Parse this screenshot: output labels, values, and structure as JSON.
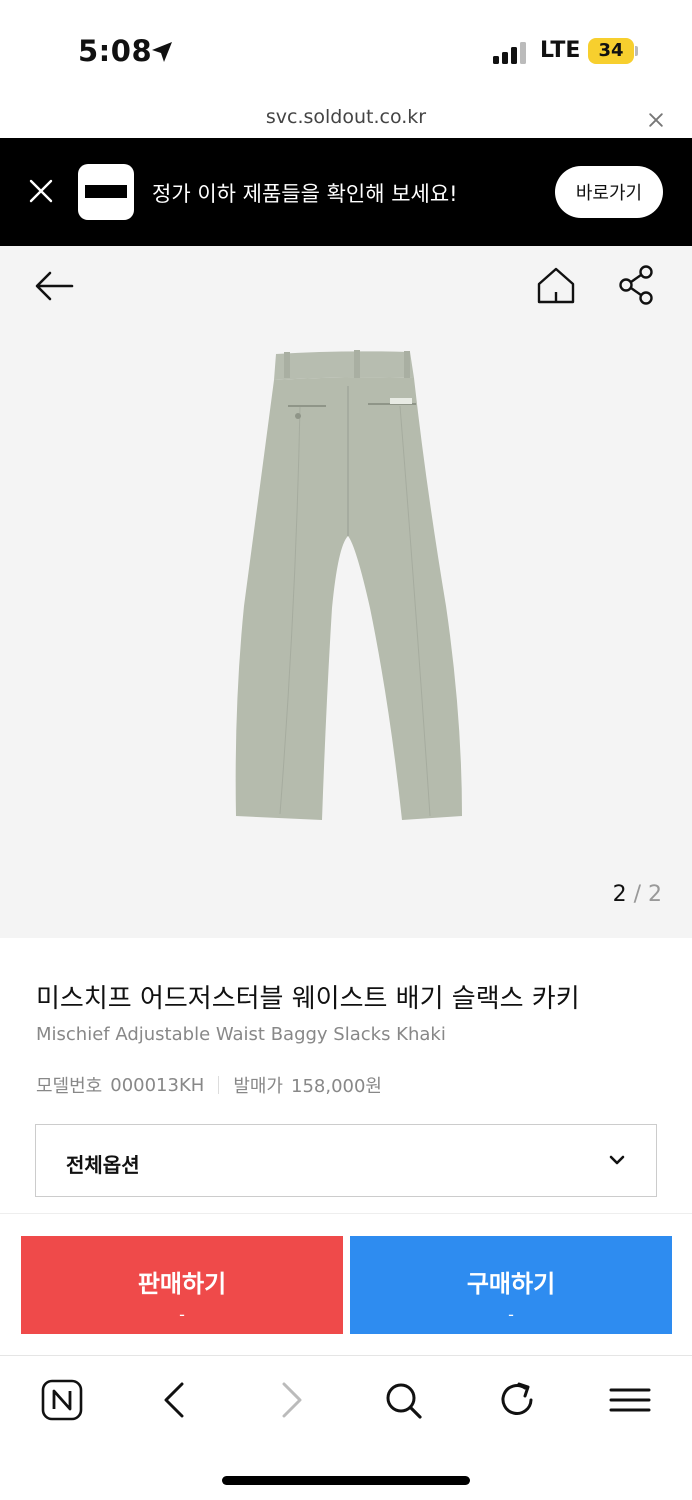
{
  "status_bar": {
    "time": "5:08",
    "network": "LTE",
    "battery": "34",
    "icons": [
      "location-arrow-icon",
      "signal-icon",
      "battery-icon"
    ]
  },
  "browser": {
    "url": "svc.soldout.co.kr",
    "close_icon": "close-icon"
  },
  "banner": {
    "message": "정가 이하 제품들을 확인해 보세요!",
    "button_label": "바로가기",
    "colors": {
      "background": "#000000",
      "text": "#ffffff"
    }
  },
  "gallery": {
    "current": "2",
    "separator": "/",
    "total": "2",
    "icons": [
      "back-arrow-icon",
      "home-icon",
      "share-icon"
    ]
  },
  "product": {
    "name_ko": "미스치프 어드저스터블 웨이스트 배기 슬랙스 카키",
    "name_en": "Mischief Adjustable Waist Baggy Slacks Khaki",
    "model_label": "모델번호",
    "model_value": "000013KH",
    "price_label": "발매가",
    "price_value": "158,000원"
  },
  "options": {
    "label": "전체옵션"
  },
  "actions": {
    "sell_label": "판매하기",
    "sell_sub": "-",
    "buy_label": "구매하기",
    "buy_sub": "-",
    "colors": {
      "sell": "#ef4a4a",
      "buy": "#2e8cf0"
    }
  },
  "toolbar": {
    "icons": [
      "naver-n-icon",
      "back-icon",
      "forward-icon",
      "search-icon",
      "reload-icon",
      "menu-icon"
    ]
  }
}
